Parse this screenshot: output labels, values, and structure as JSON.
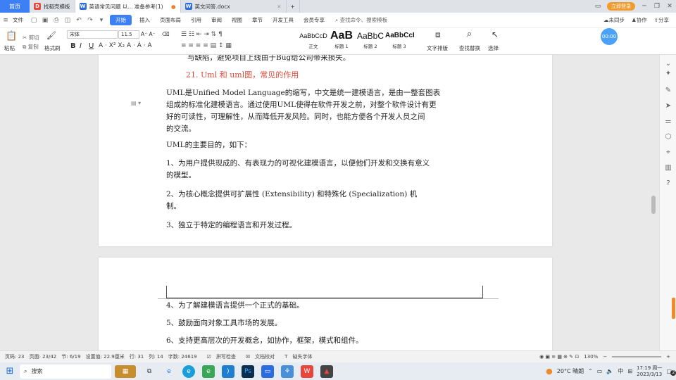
{
  "tabs": {
    "home": "首页",
    "items": [
      {
        "label": "找稻壳模板"
      },
      {
        "label": "英语常见问题 以... 准备参考(1)"
      },
      {
        "label": "英文问答.docx"
      }
    ],
    "login": "立即登录"
  },
  "menu": {
    "file": "文件",
    "items": [
      "开始",
      "插入",
      "页面布局",
      "引用",
      "审阅",
      "视图",
      "章节",
      "开发工具",
      "会员专享"
    ],
    "search": "查找命令、搜索模板",
    "right": [
      "未同步",
      "协作",
      "分享"
    ]
  },
  "ribbon": {
    "paste": "粘贴",
    "cut": "剪切",
    "copy": "复制",
    "format_painter": "格式刷",
    "font_name": "宋体",
    "font_size": "11.5",
    "styles": [
      {
        "sample": "AaBbCcD",
        "label": "正文"
      },
      {
        "sample": "AaB",
        "label": "标题 1"
      },
      {
        "sample": "AaBbC",
        "label": "标题 2"
      },
      {
        "sample": "AaBbCcI",
        "label": "标题 3"
      }
    ],
    "text_layout": "文字排版",
    "find_replace": "查找替换",
    "select": "选择",
    "timer": "00:00"
  },
  "doc": {
    "page1": {
      "line_top": "与缺陷，避免项目上线由于Bug给公司带来损失。",
      "heading": "21. Uml 和 uml图，常见的作用",
      "para1": [
        "UML是Unified Model Language的缩写，中文是统一建模语言，是由一整套图表",
        "组成的标准化建模语言。通过使用UML使得在软件开发之前，对整个软件设计有更",
        "好的可读性，可理解性，从而降低开发风险。同时，也能方便各个开发人员之间",
        "的交流。"
      ],
      "para2": "UML的主要目的，如下：",
      "item1": [
        "1、为用户提供现成的、有表现力的可视化建模语言，以便他们开发和交换有意义",
        "的模型。"
      ],
      "item2": [
        "2、为核心概念提供可扩展性 (Extensibility) 和特殊化 (Specialization) 机",
        "制。"
      ],
      "item3": "3、独立于特定的编程语言和开发过程。"
    },
    "page2": {
      "item4": "4、为了解建模语言提供一个正式的基础。",
      "item5": "5、鼓励面向对象工具市场的发展。",
      "item6": "6、支持更高层次的开发概念，如协作，框架，模式和组件。"
    }
  },
  "status": {
    "page_count": "页码: 23",
    "page": "页面: 23/42",
    "section": "节: 6/19",
    "setting": "设置值: 22.9厘米",
    "row": "行: 31",
    "col": "列: 14",
    "words": "字数: 24619",
    "spell": "拼写检查",
    "proof": "文档校对",
    "missing_font": "缺失字体",
    "zoom": "130%"
  },
  "taskbar": {
    "search": "搜索",
    "weather": "20°C 晴朗",
    "ime": "中",
    "time": "17:19 周一",
    "date": "2023/3/13",
    "badge": "2"
  }
}
